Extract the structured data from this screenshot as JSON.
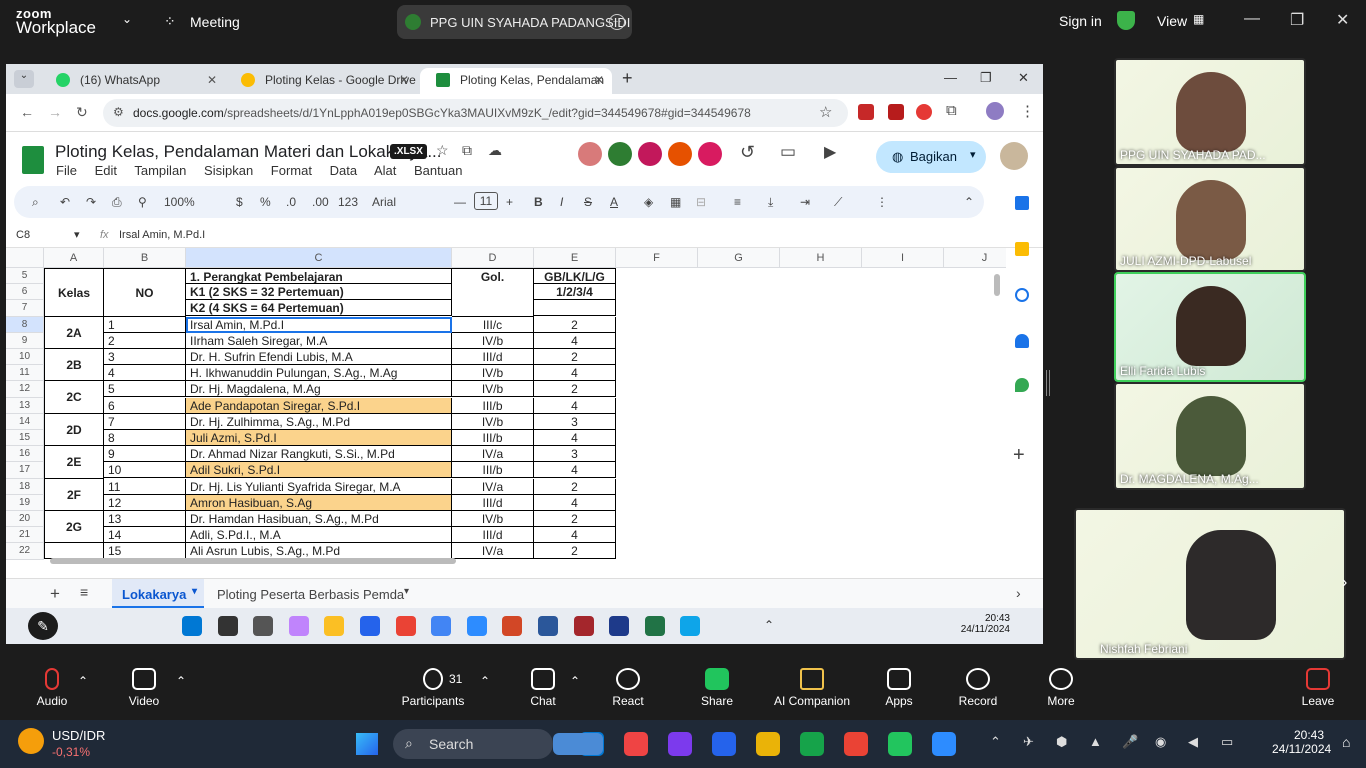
{
  "zoom": {
    "logo_top": "zoom",
    "logo_bottom": "Workplace",
    "meeting": "Meeting",
    "share_title": "PPG UIN SYAHADA PADANGSIDI",
    "sign_in": "Sign in",
    "view": "View"
  },
  "browser": {
    "tabs": [
      "(16) WhatsApp",
      "Ploting Kelas - Google Drive",
      "Ploting Kelas, Pendalaman Mate"
    ],
    "url_host": "docs.google.com",
    "url_path": "/spreadsheets/d/1YnLpphA019ep0SBGcYka3MAUIXvM9zK_/edit?gid=344549678#gid=344549678"
  },
  "sheet": {
    "title": "Ploting Kelas, Pendalaman Materi dan Lokakarya...",
    "badge": ".XLSX",
    "menus": [
      "File",
      "Edit",
      "Tampilan",
      "Sisipkan",
      "Format",
      "Data",
      "Alat",
      "Bantuan"
    ],
    "share": "Bagikan",
    "zoom_level": "100%",
    "font": "Arial",
    "font_size": "11",
    "cell_ref": "C8",
    "formula": "Irsal Amin, M.Pd.I",
    "col_headers": [
      "A",
      "B",
      "C",
      "D",
      "E",
      "F",
      "G",
      "H",
      "I",
      "J"
    ],
    "row_numbers": [
      "5",
      "6",
      "7",
      "8",
      "9",
      "10",
      "11",
      "12",
      "13",
      "14",
      "15",
      "16",
      "17",
      "18",
      "19",
      "20",
      "21",
      "22"
    ],
    "header_kelas": "Kelas",
    "header_no": "NO",
    "header_c1": "1. Perangkat Pembelajaran",
    "header_c2": "K1 (2 SKS = 32 Pertemuan)",
    "header_c3": "K2 (4 SKS = 64 Pertemuan)",
    "header_gol": "Gol.",
    "header_e1": "GB/LK/L/G",
    "header_e2": "1/2/3/4",
    "rows": [
      {
        "no": "1",
        "name": "Irsal Amin, M.Pd.I",
        "gol": "III/c",
        "e": "2",
        "hl": false
      },
      {
        "no": "2",
        "name": "IIrham Saleh Siregar, M.A",
        "gol": "IV/b",
        "e": "4",
        "hl": false
      },
      {
        "no": "3",
        "name": "Dr. H. Sufrin Efendi Lubis, M.A",
        "gol": "III/d",
        "e": "2",
        "hl": false
      },
      {
        "no": "4",
        "name": "H. Ikhwanuddin Pulungan, S.Ag., M.Ag",
        "gol": "IV/b",
        "e": "4",
        "hl": false
      },
      {
        "no": "5",
        "name": "Dr. Hj. Magdalena, M.Ag",
        "gol": "IV/b",
        "e": "2",
        "hl": false
      },
      {
        "no": "6",
        "name": "Ade Pandapotan Siregar, S.Pd.I",
        "gol": "III/b",
        "e": "4",
        "hl": true
      },
      {
        "no": "7",
        "name": "Dr. Hj. Zulhimma, S.Ag., M.Pd",
        "gol": "IV/b",
        "e": "3",
        "hl": false
      },
      {
        "no": "8",
        "name": "Juli Azmi, S.Pd.I",
        "gol": "III/b",
        "e": "4",
        "hl": true
      },
      {
        "no": "9",
        "name": "Dr. Ahmad Nizar Rangkuti, S.Si., M.Pd",
        "gol": "IV/a",
        "e": "3",
        "hl": false
      },
      {
        "no": "10",
        "name": "Adil Sukri, S.Pd.I",
        "gol": "III/b",
        "e": "4",
        "hl": true
      },
      {
        "no": "11",
        "name": "Dr. Hj. Lis Yulianti Syafrida Siregar, M.A",
        "gol": "IV/a",
        "e": "2",
        "hl": false
      },
      {
        "no": "12",
        "name": "Amron Hasibuan, S.Ag",
        "gol": "III/d",
        "e": "4",
        "hl": true
      },
      {
        "no": "13",
        "name": "Dr. Hamdan Hasibuan, S.Ag., M.Pd",
        "gol": "IV/b",
        "e": "2",
        "hl": false
      },
      {
        "no": "14",
        "name": "Adli, S.Pd.I., M.A",
        "gol": "III/d",
        "e": "4",
        "hl": false
      },
      {
        "no": "15",
        "name": "Ali Asrun Lubis, S.Ag., M.Pd",
        "gol": "IV/a",
        "e": "2",
        "hl": false
      }
    ],
    "classes": [
      "2A",
      "2B",
      "2C",
      "2D",
      "2E",
      "2F",
      "2G"
    ],
    "sheet_tabs": [
      "Lokakarya",
      "Ploting Peserta Berbasis Pemda"
    ]
  },
  "inner_clock": {
    "time": "20:43",
    "date": "24/11/2024"
  },
  "participants": [
    "PPG UIN SYAHADA PAD...",
    "JULI AZMI-DPD-Labusel",
    "Elli Farida Lubis",
    "Dr. MAGDALENA, M.Ag...",
    "Nishfah Febriani"
  ],
  "controls": {
    "audio": "Audio",
    "video": "Video",
    "participants": "Participants",
    "participant_count": "31",
    "chat": "Chat",
    "react": "React",
    "share": "Share",
    "ai": "AI Companion",
    "apps": "Apps",
    "record": "Record",
    "more": "More",
    "leave": "Leave"
  },
  "taskbar": {
    "ticker": "USD/IDR",
    "change": "-0,31%",
    "search": "Search",
    "time": "20:43",
    "date": "24/11/2024"
  }
}
